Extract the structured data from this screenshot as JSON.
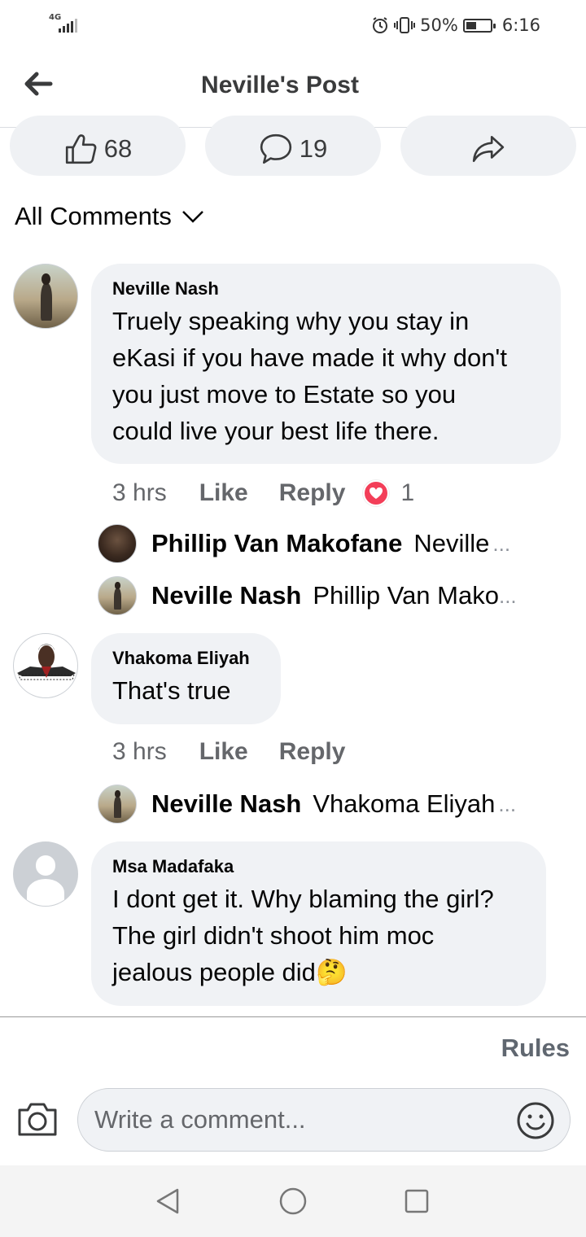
{
  "status_bar": {
    "network": "4G",
    "battery_text": "50%",
    "battery_level": 0.5,
    "time": "6:16",
    "icons": [
      "signal-icon",
      "alarm-icon",
      "vibrate-icon",
      "battery-icon"
    ]
  },
  "header": {
    "title": "Neville's Post",
    "back_icon": "arrow-left-icon"
  },
  "reactions": {
    "like_count": "68",
    "comment_count": "19",
    "like_icon": "thumbs-up-icon",
    "comment_icon": "speech-bubble-icon",
    "share_icon": "share-arrow-icon"
  },
  "filter": {
    "label": "All Comments",
    "icon": "chevron-down-icon"
  },
  "comments": [
    {
      "author": "Neville Nash",
      "lines": [
        "Truely speaking why you stay in",
        "eKasi if you have made it why don't",
        "you just move to Estate so you",
        "could live your best life there."
      ],
      "time": "3 hrs",
      "like_label": "Like",
      "reply_label": "Reply",
      "reaction_count": "1",
      "reaction_icon": "love-reaction-icon",
      "replies": [
        {
          "author": "Phillip Van Makofane",
          "preview": "Neville",
          "ellipsis": "..."
        },
        {
          "author": "Neville Nash",
          "preview": "Phillip Van Mako",
          "ellipsis": "..."
        }
      ]
    },
    {
      "author": "Vhakoma Eliyah",
      "lines": [
        "That's true"
      ],
      "time": "3 hrs",
      "like_label": "Like",
      "reply_label": "Reply",
      "replies": [
        {
          "author": "Neville Nash",
          "preview": "Vhakoma Eliyah",
          "ellipsis": "..."
        }
      ]
    },
    {
      "author": "Msa Madafaka",
      "lines": [
        "I dont get it. Why blaming the girl?",
        "The girl didn't shoot him moc",
        "jealous people did"
      ],
      "emoji": "🤔"
    }
  ],
  "footer": {
    "rules_label": "Rules",
    "comment_placeholder": "Write a comment...",
    "camera_icon": "camera-icon",
    "emoji_icon": "smiley-icon"
  },
  "nav_bar": {
    "icons": [
      "back-triangle-icon",
      "home-circle-icon",
      "recents-square-icon"
    ]
  },
  "colors": {
    "bubble_bg": "#f0f2f5",
    "secondary_text": "#65676b",
    "love_red": "#f33e58"
  }
}
